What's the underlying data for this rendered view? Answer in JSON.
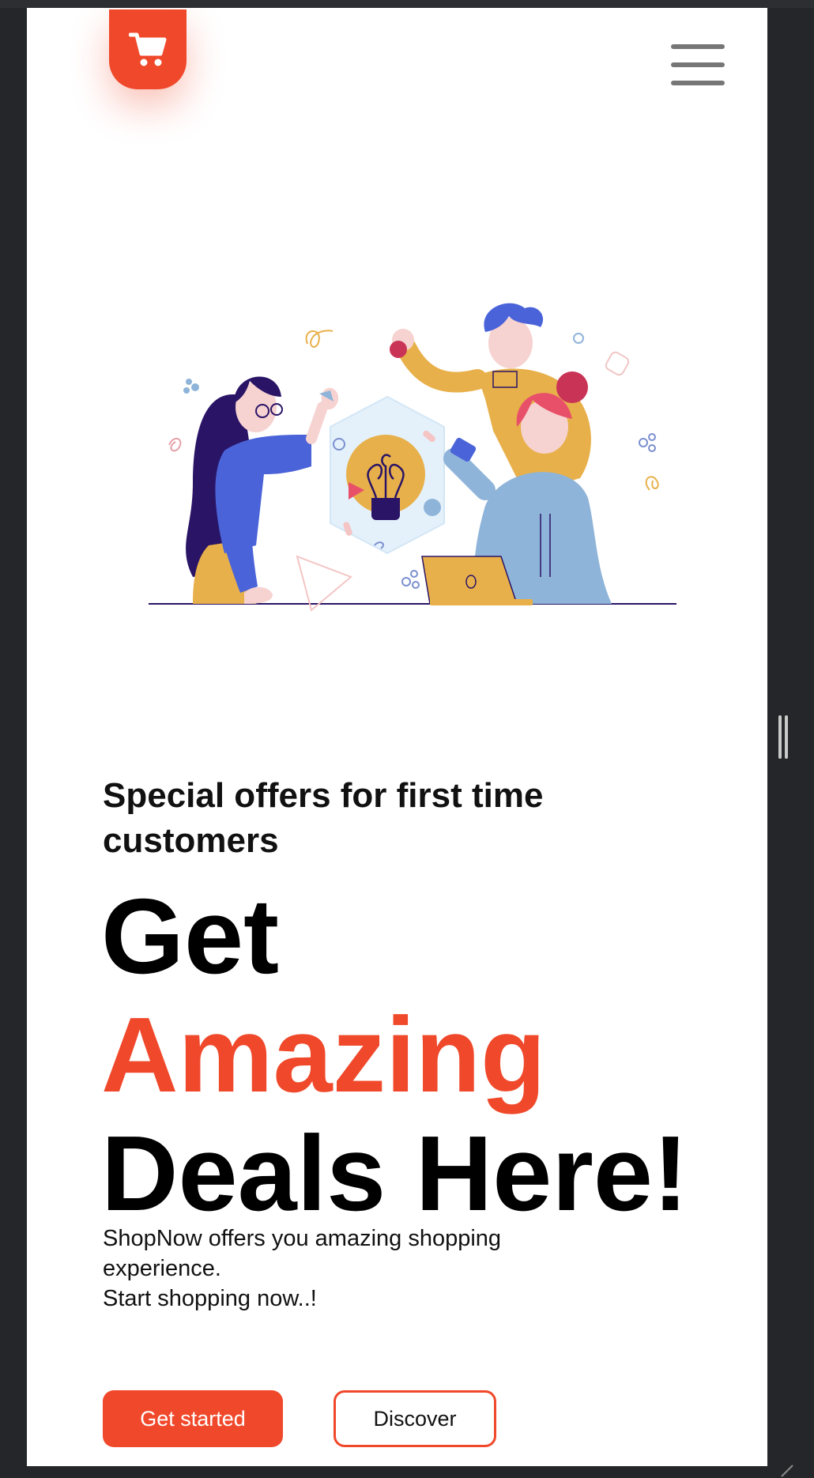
{
  "header": {
    "logo_icon": "shopping-cart-icon",
    "menu_icon": "hamburger-menu-icon"
  },
  "hero": {
    "subtitle": "Special offers for first time customers",
    "headline_line1": "Get",
    "headline_accent": "Amazing",
    "headline_line3": "Deals Here!",
    "description_line1": "ShopNow offers you amazing shopping experience.",
    "description_line2": "Start shopping now..!"
  },
  "actions": {
    "primary_label": "Get started",
    "secondary_label": "Discover"
  },
  "colors": {
    "brand": "#f0482a",
    "text": "#000000",
    "background": "#ffffff",
    "frame": "#252629"
  }
}
